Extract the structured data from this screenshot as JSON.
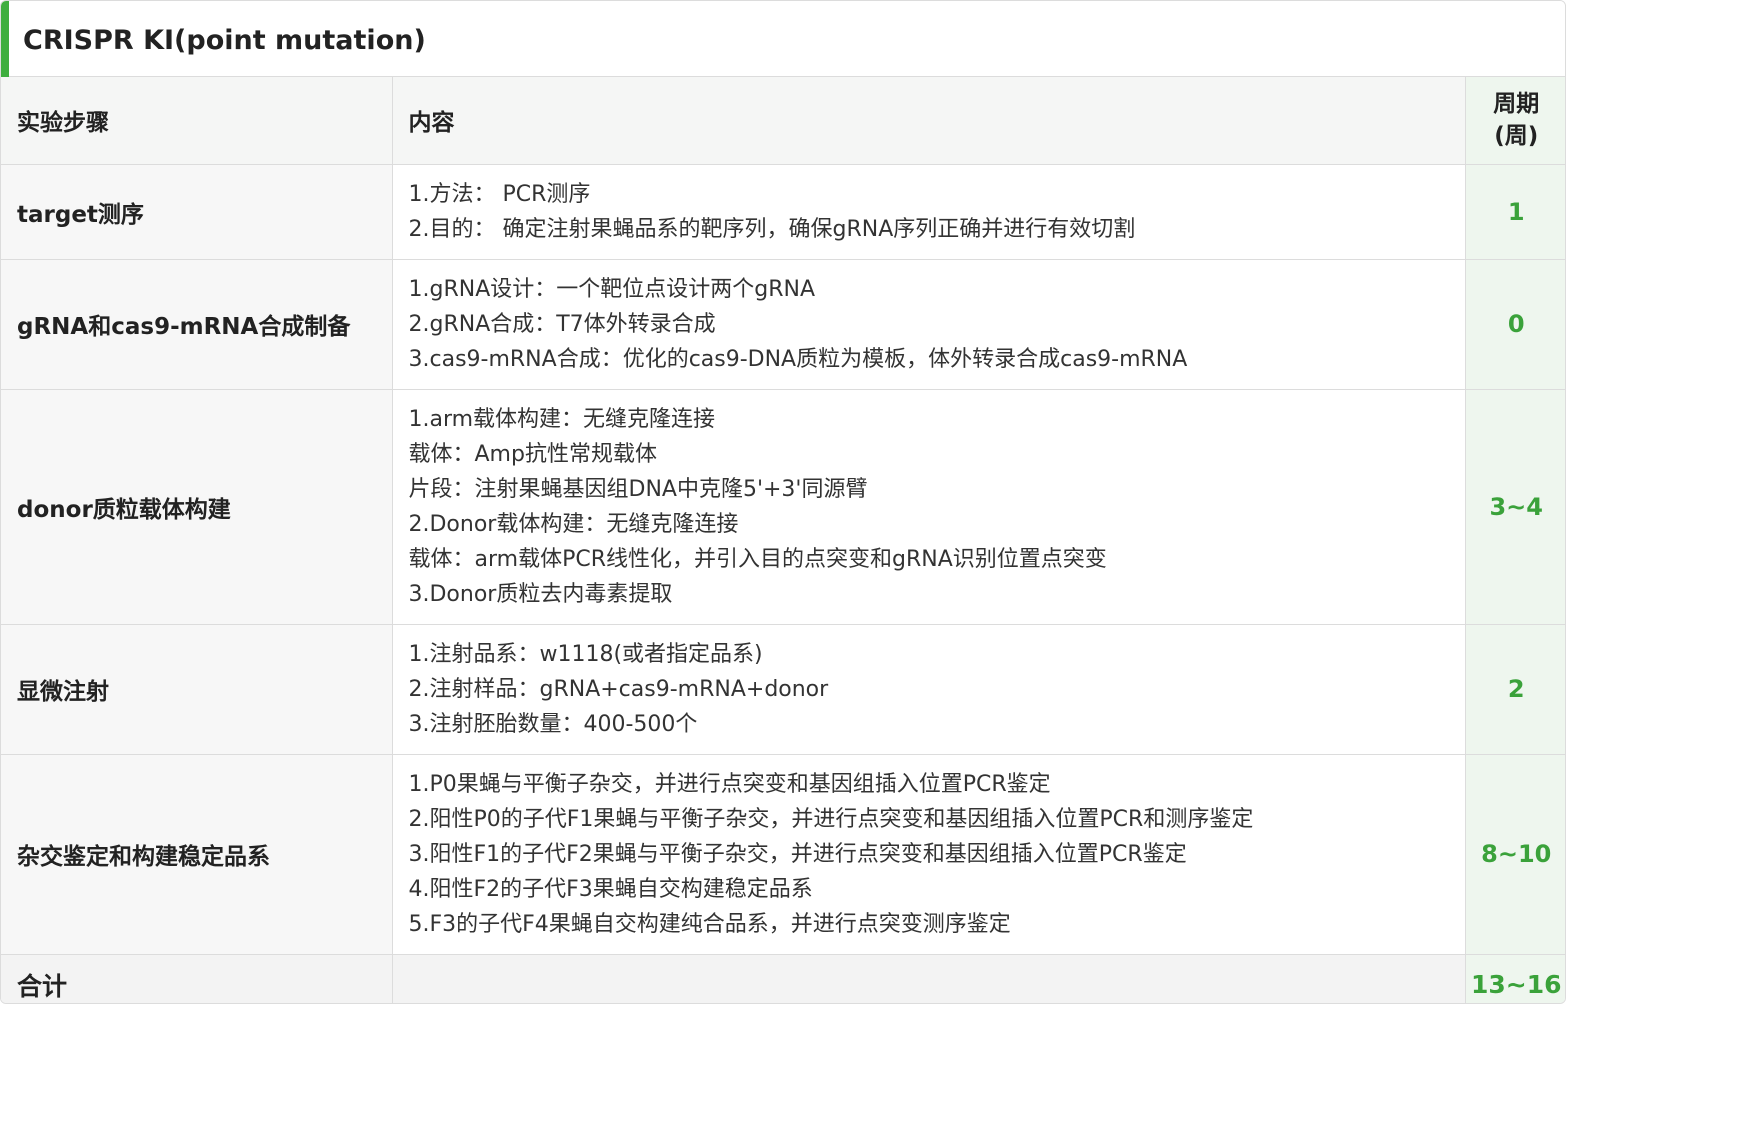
{
  "title": "CRISPR KI(point mutation)",
  "header": {
    "step": "实验步骤",
    "content": "内容",
    "period_line1": "周期",
    "period_line2": "(周)"
  },
  "rows": [
    {
      "step": "target测序",
      "lines": [
        "1.方法： PCR测序",
        "2.目的： 确定注射果蝇品系的靶序列，确保gRNA序列正确并进行有效切割"
      ],
      "period": "1"
    },
    {
      "step": "gRNA和cas9-mRNA合成制备",
      "lines": [
        "1.gRNA设计：一个靶位点设计两个gRNA",
        "2.gRNA合成：T7体外转录合成",
        "3.cas9-mRNA合成：优化的cas9-DNA质粒为模板，体外转录合成cas9-mRNA"
      ],
      "period": "0"
    },
    {
      "step": "donor质粒载体构建",
      "lines": [
        "1.arm载体构建：无缝克隆连接",
        "载体：Amp抗性常规载体",
        "片段：注射果蝇基因组DNA中克隆5'+3'同源臂",
        "2.Donor载体构建：无缝克隆连接",
        "载体：arm载体PCR线性化，并引入目的点突变和gRNA识别位置点突变",
        "3.Donor质粒去内毒素提取"
      ],
      "period": "3~4"
    },
    {
      "step": "显微注射",
      "lines": [
        "1.注射品系：w1118(或者指定品系)",
        "2.注射样品：gRNA+cas9-mRNA+donor",
        "3.注射胚胎数量：400-500个"
      ],
      "period": "2"
    },
    {
      "step": "杂交鉴定和构建稳定品系",
      "lines": [
        "1.P0果蝇与平衡子杂交，并进行点突变和基因组插入位置PCR鉴定",
        "2.阳性P0的子代F1果蝇与平衡子杂交，并进行点突变和基因组插入位置PCR和测序鉴定",
        "3.阳性F1的子代F2果蝇与平衡子杂交，并进行点突变和基因组插入位置PCR鉴定",
        "4.阳性F2的子代F3果蝇自交构建稳定品系",
        "5.F3的子代F4果蝇自交构建纯合品系，并进行点突变测序鉴定"
      ],
      "period": "8~10"
    }
  ],
  "total": {
    "label": "合计",
    "content": "",
    "period": "13~16"
  },
  "colors": {
    "accent": "#3fae3f",
    "period_text": "#3aa23a",
    "period_bg": "#eef6ee"
  }
}
